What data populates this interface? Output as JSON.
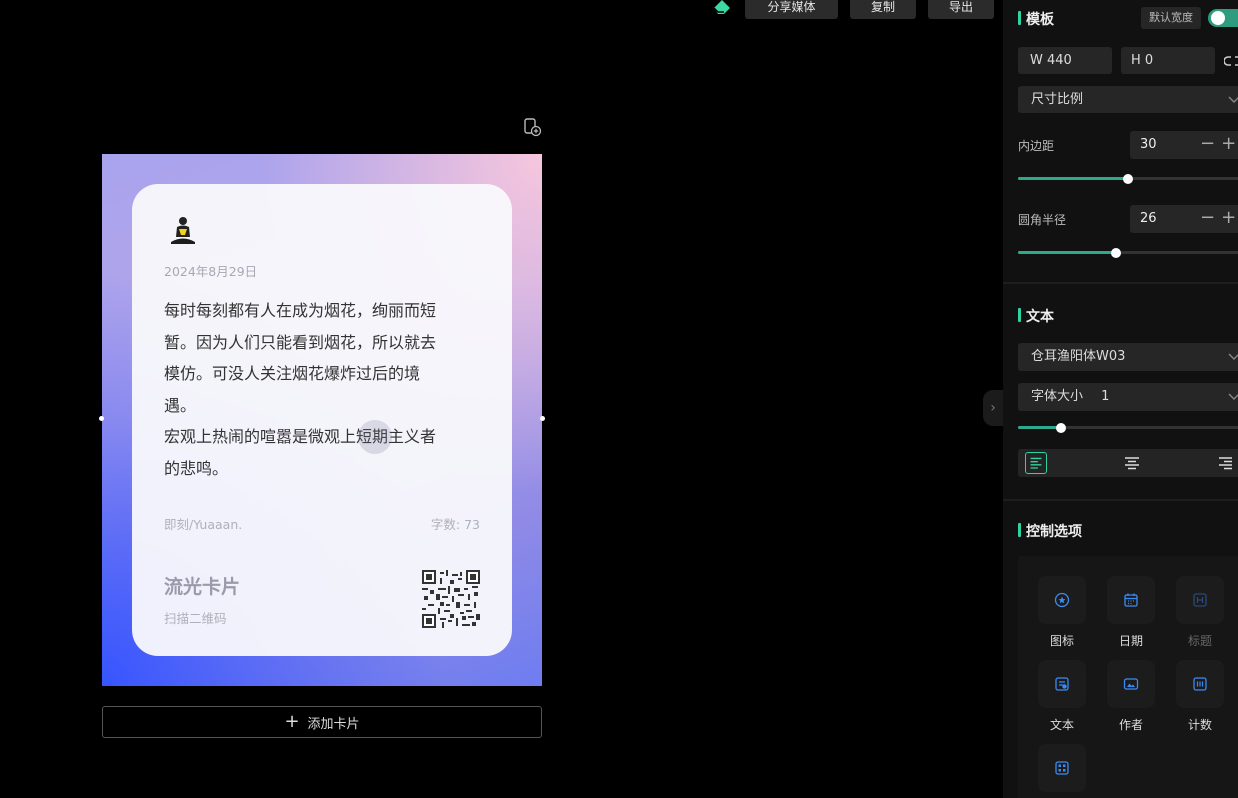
{
  "toolbar": {
    "eraser_icon": "eraser-icon",
    "share_label": "分享媒体",
    "copy_label": "复制",
    "export_label": "导出"
  },
  "card": {
    "date": "2024年8月29日",
    "body": "每时每刻都有人在成为烟花，绚丽而短\n暂。因为人们只能看到烟花，所以就去\n模仿。可没人关注烟花爆炸过后的境\n遇。\n宏观上热闹的喧嚣是微观上短期主义者\n的悲鸣。",
    "author": "即刻/Yuaaan.",
    "word_count": "字数: 73",
    "brand": "流光卡片",
    "scan_hint": "扫描二维码",
    "gradient_colors": [
      "#fbc8dc",
      "#a9a3ee",
      "#3755ff"
    ]
  },
  "add_card_label": "添加卡片",
  "panel": {
    "template": {
      "title": "模板",
      "default_width_label": "默认宽度",
      "default_width_on": true,
      "width": "W 440",
      "height": "H 0",
      "ratio_select": "尺寸比例",
      "padding_label": "内边距",
      "padding_value": "30",
      "padding_slider": 0.46,
      "radius_label": "圆角半径",
      "radius_value": "26",
      "radius_slider": 0.41
    },
    "text": {
      "title": "文本",
      "font_select": "仓耳渔阳体W03",
      "font_size_label": "字体大小",
      "font_size_value": "1",
      "font_size_slider": 0.18,
      "align_options": [
        "align-left",
        "align-center",
        "align-right"
      ],
      "align_selected": "align-left"
    },
    "controls": {
      "title": "控制选项",
      "items": [
        {
          "label": "图标",
          "icon": "icon-icon",
          "active": true
        },
        {
          "label": "日期",
          "icon": "calendar-icon",
          "active": true
        },
        {
          "label": "标题",
          "icon": "heading-icon",
          "active": false
        },
        {
          "label": "文本",
          "icon": "text-icon",
          "active": true
        },
        {
          "label": "作者",
          "icon": "author-icon",
          "active": true
        },
        {
          "label": "计数",
          "icon": "counter-icon",
          "active": true
        },
        {
          "label": "",
          "icon": "qrcode-icon",
          "active": true
        }
      ]
    }
  },
  "accent_color": "#2fd3a1"
}
